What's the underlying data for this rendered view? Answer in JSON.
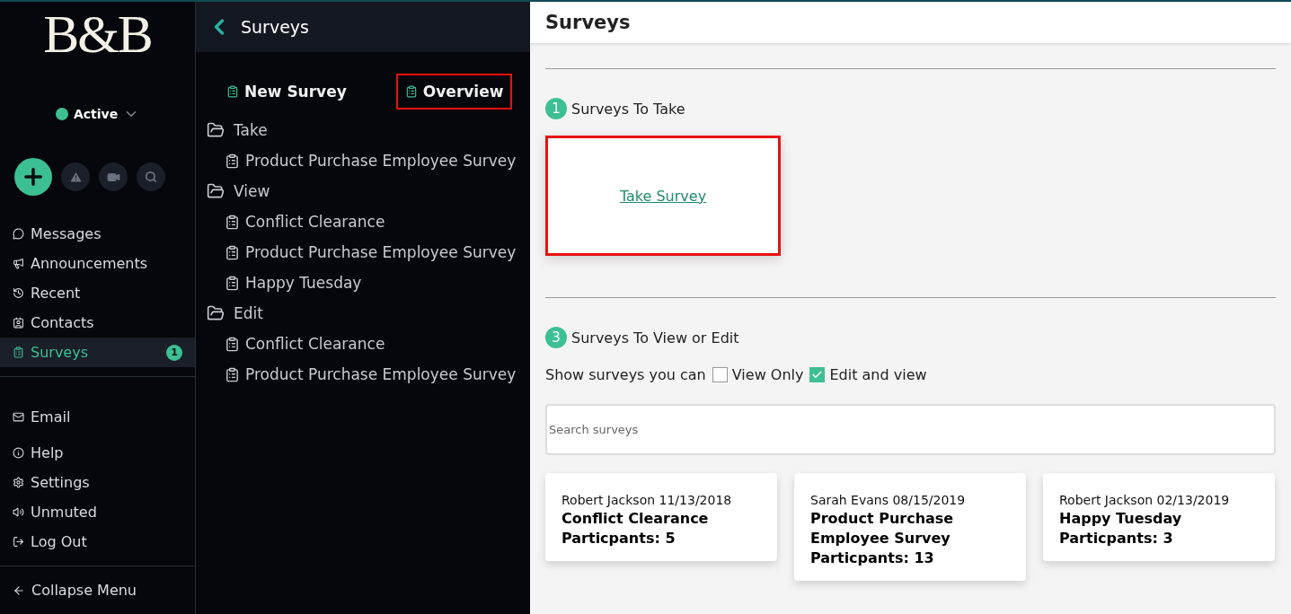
{
  "logo": {
    "text": "B&B"
  },
  "status": {
    "label": "Active",
    "color": "#3dbf94"
  },
  "nav_primary": [
    {
      "label": "Messages",
      "kind": "messages",
      "selected": false
    },
    {
      "label": "Announcements",
      "kind": "announcements",
      "selected": false
    },
    {
      "label": "Recent",
      "kind": "recent",
      "selected": false
    },
    {
      "label": "Contacts",
      "kind": "contacts",
      "selected": false
    },
    {
      "label": "Surveys",
      "kind": "surveys",
      "selected": true,
      "badge": "1"
    }
  ],
  "nav_email": [
    {
      "label": "Email",
      "kind": "email",
      "selected": false
    }
  ],
  "nav_secondary": [
    {
      "label": "Help",
      "kind": "help",
      "selected": false
    },
    {
      "label": "Settings",
      "kind": "settings",
      "selected": false
    },
    {
      "label": "Unmuted",
      "kind": "sound",
      "selected": false
    },
    {
      "label": "Log Out",
      "kind": "logout",
      "selected": false
    }
  ],
  "collapse": {
    "label": "Collapse Menu"
  },
  "panel": {
    "title": "Surveys",
    "actions": [
      {
        "label": "New Survey",
        "highlighted": false
      },
      {
        "label": "Overview",
        "highlighted": true
      }
    ],
    "folders": [
      {
        "label": "Take",
        "children": [
          {
            "label": "Product Purchase Employee Survey"
          }
        ]
      },
      {
        "label": "View",
        "children": [
          {
            "label": "Conflict Clearance"
          },
          {
            "label": "Product Purchase Employee Survey"
          },
          {
            "label": "Happy Tuesday"
          }
        ]
      },
      {
        "label": "Edit",
        "children": [
          {
            "label": "Conflict Clearance"
          },
          {
            "label": "Product Purchase Employee Survey"
          }
        ]
      }
    ]
  },
  "main": {
    "title": "Surveys",
    "take_section": {
      "step": "1",
      "title": "Surveys To Take",
      "card": {
        "link": "Take Survey",
        "highlighted": true
      }
    },
    "view_section": {
      "step": "3",
      "title": "Surveys To View or Edit",
      "filter_label": "Show surveys you can",
      "filters": [
        {
          "label": "View Only",
          "checked": false
        },
        {
          "label": "Edit and view",
          "checked": true
        }
      ],
      "search": {
        "placeholder": "Search surveys"
      },
      "cards": [
        {
          "meta": "Robert Jackson 11/13/2018",
          "title": "Conflict Clearance",
          "participants": "Particpants: 5"
        },
        {
          "meta": "Sarah Evans 08/15/2019",
          "title": "Product Purchase Employee Survey",
          "participants": "Particpants: 13"
        },
        {
          "meta": "Robert Jackson 02/13/2019",
          "title": "Happy Tuesday",
          "participants": "Particpants: 3"
        }
      ]
    }
  }
}
